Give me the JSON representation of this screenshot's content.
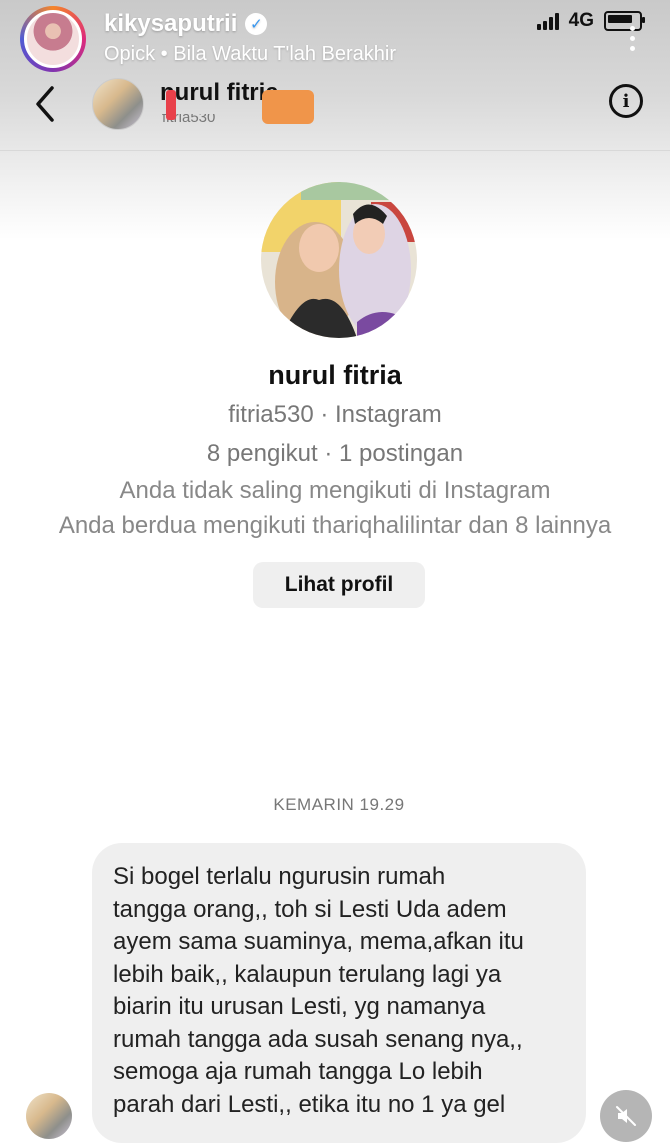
{
  "story": {
    "username": "kikysaputrii",
    "subtitle": "Opick • Bila Waktu T'lah Berakhir",
    "verified_icon": "verified-check-icon"
  },
  "status_bar": {
    "network": "4G"
  },
  "chat_header": {
    "name": "nurul fitria",
    "username": "fitria530"
  },
  "profile": {
    "name": "nurul fitria",
    "handle_line": "fitria530 · Instagram",
    "counts_line": "8 pengikut · 1 postingan",
    "follow_status": "Anda tidak saling mengikuti di Instagram",
    "mutual_line": "Anda berdua mengikuti thariqhalilintar dan 8 lainnya",
    "view_profile_label": "Lihat profil"
  },
  "thread": {
    "timestamp": "KEMARIN 19.29",
    "message_lines": [
      "Si bogel terlalu ngurusin rumah",
      "tangga orang,,  toh si Lesti Uda adem",
      "ayem sama suaminya, mema,afkan itu",
      "lebih baik,, kalaupun terulang lagi ya",
      "biarin itu urusan Lesti, yg namanya",
      "rumah tangga ada susah senang nya,,",
      "semoga aja rumah tangga Lo lebih",
      "parah dari Lesti,, etika itu no 1 ya gel"
    ]
  },
  "colors": {
    "bubble": "#efefef",
    "redaction_red": "#e8404a",
    "redaction_orange": "#f0954a"
  }
}
